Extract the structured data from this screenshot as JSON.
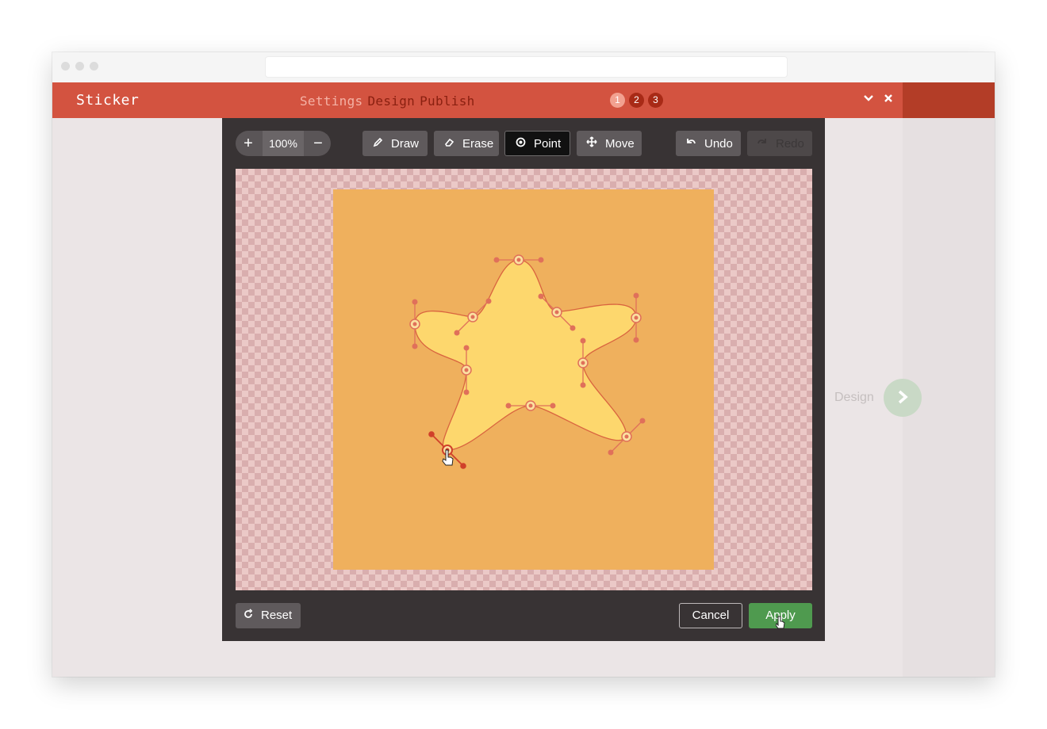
{
  "app": {
    "title": "Sticker"
  },
  "steps": [
    {
      "label": "Settings",
      "state": "done"
    },
    {
      "label": "Design",
      "state": "current"
    },
    {
      "label": "Publish",
      "state": "upcoming"
    }
  ],
  "step_badges": [
    "1",
    "2",
    "3"
  ],
  "header_icons": {
    "collapse": "chevron-down-icon",
    "close": "close-icon"
  },
  "zoom": {
    "in_label": "+",
    "value": "100%",
    "out_label": "−"
  },
  "tools": {
    "draw": "Draw",
    "erase": "Erase",
    "point": "Point",
    "move": "Move",
    "undo": "Undo",
    "redo": "Redo",
    "active": "Point",
    "disabled": [
      "Redo"
    ]
  },
  "actions": {
    "reset": "Reset",
    "cancel": "Cancel",
    "apply": "Apply"
  },
  "next": {
    "label": "Design"
  },
  "colors": {
    "header": "#d35340",
    "sticker_background": "#efb05d",
    "shape_fill": "#fdd76d",
    "control_points": "#e0705a",
    "apply": "#4f9a4f"
  }
}
